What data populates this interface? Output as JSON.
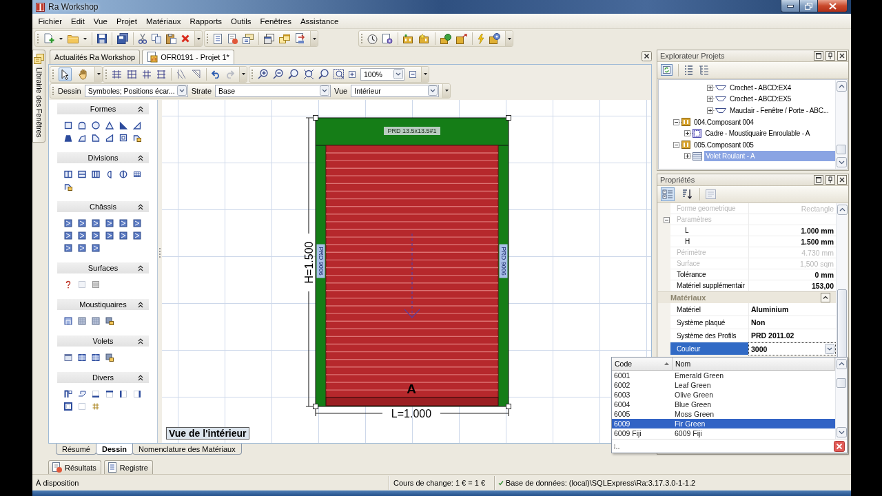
{
  "window": {
    "title": "Ra Workshop"
  },
  "menu": [
    "Fichier",
    "Edit",
    "Vue",
    "Projet",
    "Matériaux",
    "Rapports",
    "Outils",
    "Fenêtres",
    "Assistance"
  ],
  "side_tab": {
    "label": "Librairie des Fenêtres"
  },
  "document_tabs": [
    {
      "label": "Actualités Ra Workshop",
      "selected": false
    },
    {
      "label": "OFR0191 - Projet 1*",
      "selected": true
    }
  ],
  "drawing_toolbar": {
    "modes": [
      {
        "kind": "pointer",
        "selected": true
      },
      {
        "kind": "hand",
        "selected": false
      }
    ],
    "history": [
      {
        "kind": "undo",
        "disabled": false
      },
      {
        "kind": "redo",
        "disabled": true
      }
    ],
    "zoom": "100%"
  },
  "view_bar": [
    {
      "label": "Dessin",
      "value": "Symboles; Positions écar..."
    },
    {
      "label": "Strate",
      "value": "Base"
    },
    {
      "label": "Vue",
      "value": "Intérieur"
    }
  ],
  "palette": [
    {
      "title": "Formes",
      "expanded": true
    },
    {
      "title": "Divisions",
      "expanded": true
    },
    {
      "title": "Châssis",
      "expanded": true
    },
    {
      "title": "Surfaces",
      "expanded": true
    },
    {
      "title": "Moustiquaires",
      "expanded": true
    },
    {
      "title": "Volets",
      "expanded": true
    },
    {
      "title": "Divers",
      "expanded": true
    }
  ],
  "drawing": {
    "head_label": "PRD 13.5x13.5#1",
    "left_label": "PRD 9006",
    "right_label": "PRD 9006",
    "sash_label": "A",
    "height_label": "H=1.500",
    "width_label": "L=1.000"
  },
  "view_caption": "Vue de l'intérieur",
  "sheet_tabs": [
    {
      "label": "Résumé",
      "selected": false
    },
    {
      "label": "Dessin",
      "selected": true
    },
    {
      "label": "Nomenclature des Matériaux",
      "selected": false
    }
  ],
  "output_tabs": [
    {
      "label": "Résultats",
      "selected": false
    },
    {
      "label": "Registre",
      "selected": false
    }
  ],
  "explorer": {
    "title": "Explorateur Projets",
    "tree": [
      {
        "children": [
          {
            "children": [
              {
                "children": [
                  {
                    "label": "Crochet - ABCD:EX4",
                    "kind": "hardware",
                    "expanded": false,
                    "selected": false
                  },
                  {
                    "label": "Crochet - ABCD:EX5",
                    "kind": "hardware",
                    "expanded": false,
                    "selected": false
                  },
                  {
                    "label": "Mauclair - Fenêtre / Porte - ABC...",
                    "kind": "hardware",
                    "expanded": false,
                    "selected": false
                  }
                ]
              }
            ]
          }
        ]
      },
      {
        "label": "004.Composant 004",
        "kind": "component",
        "expanded": true,
        "selected": false,
        "children": [
          {
            "label": "Cadre - Moustiquaire Enroulable - A",
            "kind": "frame",
            "expanded": false,
            "selected": false
          }
        ]
      },
      {
        "label": "005.Composant 005",
        "kind": "component",
        "expanded": true,
        "selected": false,
        "children": [
          {
            "label": "Volet Roulant - A",
            "kind": "shutter",
            "expanded": false,
            "selected": true
          }
        ]
      }
    ]
  },
  "properties": {
    "title": "Propriétés",
    "view_modes": [
      {
        "kind": "categorized",
        "selected": true
      },
      {
        "kind": "alphabetical",
        "selected": false
      }
    ],
    "groups": [
      {
        "kind": "plain",
        "rows": [
          {
            "kind": "field",
            "name": "Forme geometrique",
            "value": "Rectangle",
            "disabled": true,
            "selected": false
          },
          {
            "kind": "group",
            "name": "Paramètres",
            "expanded": true,
            "disabled": true,
            "selected": false,
            "children": [
              {
                "kind": "field",
                "name": "L",
                "value": "1.000 mm",
                "disabled": false,
                "selected": false
              },
              {
                "kind": "field",
                "name": "H",
                "value": "1.500 mm",
                "disabled": false,
                "selected": false
              }
            ]
          },
          {
            "kind": "field",
            "name": "Périmètre",
            "value": "4.730 mm",
            "disabled": true,
            "selected": false
          },
          {
            "kind": "field",
            "name": "Surface",
            "value": "1,500 sqm",
            "disabled": true,
            "selected": false
          },
          {
            "kind": "field",
            "name": "Tolérance",
            "value": "0 mm",
            "disabled": false,
            "selected": false
          },
          {
            "kind": "field",
            "name": "Matériel supplémentair",
            "value": "153,00",
            "disabled": false,
            "selected": false
          }
        ]
      },
      {
        "kind": "section",
        "title": "Matériaux",
        "expanded": true,
        "rows": [
          {
            "kind": "field",
            "name": "Matériel",
            "value": "Aluminium",
            "disabled": false,
            "selected": false
          },
          {
            "kind": "field",
            "name": "Système plaqué",
            "value": "Non",
            "disabled": false,
            "selected": false
          },
          {
            "kind": "field",
            "name": "Système des Profils",
            "value": "PRD 2011.02",
            "disabled": false,
            "selected": false
          },
          {
            "kind": "field",
            "name": "Couleur",
            "value": "3000",
            "disabled": false,
            "selected": true
          }
        ]
      }
    ]
  },
  "color_picker": {
    "columns": [
      {
        "label": "Code",
        "sorted": true
      },
      {
        "label": "Nom",
        "sorted": false
      }
    ],
    "rows": [
      {
        "code": "6001",
        "name": "Emerald Green",
        "selected": false
      },
      {
        "code": "6002",
        "name": "Leaf Green",
        "selected": false
      },
      {
        "code": "6003",
        "name": "Olive Green",
        "selected": false
      },
      {
        "code": "6004",
        "name": "Blue Green",
        "selected": false
      },
      {
        "code": "6005",
        "name": "Moss Green",
        "selected": false
      },
      {
        "code": "6009",
        "name": "Fir Green",
        "selected": true
      },
      {
        "code": "6009 Fiji",
        "name": "6009 Fiji",
        "selected": false
      }
    ]
  },
  "status_bar": {
    "state": "À disposition",
    "exchange": "Cours de change: 1 € = 1 €",
    "database": "Base de données: (local)\\SQLExpress\\Ra:3.17.3.0-1-1.2"
  }
}
